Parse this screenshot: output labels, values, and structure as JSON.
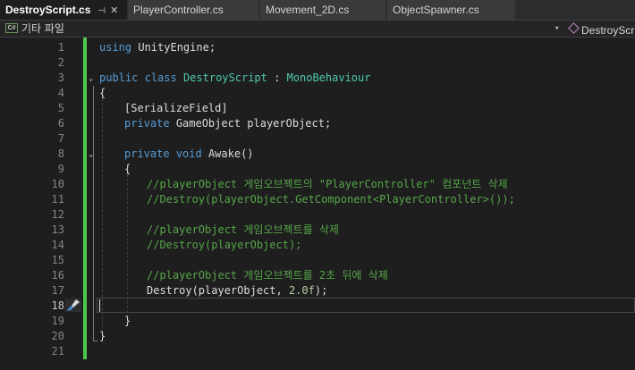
{
  "tabs": [
    {
      "label": "DestroyScript.cs",
      "active": true
    },
    {
      "label": "PlayerController.cs",
      "active": false
    },
    {
      "label": "Movement_2D.cs",
      "active": false
    },
    {
      "label": "ObjectSpawner.cs",
      "active": false
    }
  ],
  "tab_pin_glyph": "⊣",
  "tab_close_glyph": "✕",
  "navbar": {
    "badge": "C#",
    "left_label": "기타 파일",
    "right_label": "DestroyScript"
  },
  "editor": {
    "current_line": 18,
    "line_numbers": [
      "1",
      "2",
      "3",
      "4",
      "5",
      "6",
      "7",
      "8",
      "9",
      "10",
      "11",
      "12",
      "13",
      "14",
      "15",
      "16",
      "17",
      "18",
      "19",
      "20",
      "21"
    ],
    "lines": {
      "l1": {
        "kw": "using",
        "rest": " UnityEngine;"
      },
      "l3": {
        "kw1": "public",
        "kw2": "class",
        "type1": "DestroyScript",
        "sep": " : ",
        "type2": "MonoBehaviour"
      },
      "l4": "{",
      "l5": "[SerializeField]",
      "l6": {
        "kw": "private",
        "type": "GameObject",
        "rest": " playerObject;"
      },
      "l8": {
        "kw1": "private",
        "kw2": "void",
        "rest": " Awake()"
      },
      "l9": "{",
      "l10": "//playerObject 게임오브젝트의 \"PlayerController\" 컴포넌트 삭제",
      "l11": "//Destroy(playerObject.GetComponent<PlayerController>());",
      "l13": "//playerObject 게임오브젝트를 삭제",
      "l14": "//Destroy(playerObject);",
      "l16": "//playerObject 게임오브젝트를 2초 뒤에 삭제",
      "l17": {
        "fn": "Destroy(playerObject, ",
        "num": "2.0f",
        "end": ");"
      },
      "l19": "}",
      "l20": "}"
    }
  },
  "colors": {
    "keyword": "#569cd6",
    "type": "#4ec9b0",
    "comment": "#57a64a",
    "number": "#b5cea8",
    "change_bar": "#4ec94e"
  }
}
